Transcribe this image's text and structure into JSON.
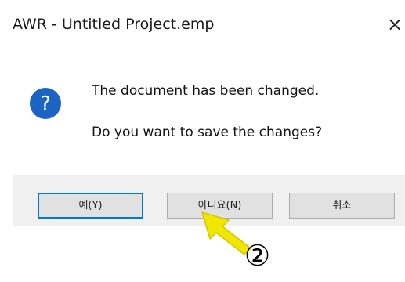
{
  "window": {
    "title": "AWR - Untitled Project.emp",
    "close_glyph": "×"
  },
  "dialog": {
    "icon": "question-icon",
    "message_line1": "The document has been changed.",
    "message_line2": "Do you want to save the changes?"
  },
  "buttons": {
    "yes_label": "예(Y)",
    "no_label": "아니요(N)",
    "cancel_label": "취소"
  },
  "annotation": {
    "step_label": "②",
    "pointer_icon": "yellow-arrow-pointer",
    "pointer_color": "#f0e600"
  },
  "colors": {
    "icon_blue": "#1b64c4",
    "default_button_border": "#0078d7",
    "button_bar_bg": "#f0f0f0"
  }
}
